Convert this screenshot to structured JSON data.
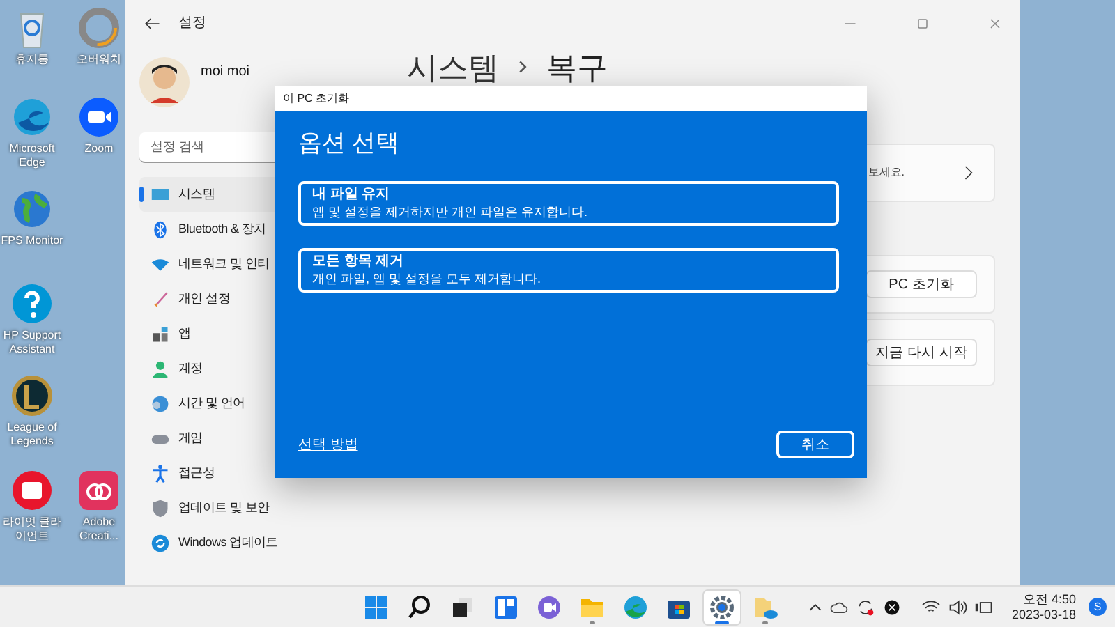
{
  "desktop_icons": [
    {
      "label": "휴지통",
      "kind": "recycle"
    },
    {
      "label": "오버워치",
      "kind": "ring"
    },
    {
      "label": "Microsoft Edge",
      "kind": "edge"
    },
    {
      "label": "Zoom",
      "kind": "zoom"
    },
    {
      "label": "FPS Monitor",
      "kind": "globe"
    },
    {
      "label": "HP Support Assistant",
      "kind": "help"
    },
    {
      "label": "League of Legends",
      "kind": "league"
    },
    {
      "label": "라이엇 클라이언트",
      "kind": "fist"
    },
    {
      "label": "Adobe Creati...",
      "kind": "adobe"
    }
  ],
  "settings": {
    "title": "설정",
    "user": {
      "name": "moi moi"
    },
    "search": {
      "placeholder": "설정 검색"
    },
    "sidebar": {
      "items": [
        {
          "label": "시스템",
          "kind": "system",
          "selected": true
        },
        {
          "label": "Bluetooth & 장치",
          "kind": "bluetooth",
          "selected": false
        },
        {
          "label": "네트워크 및 인터",
          "kind": "network",
          "selected": false
        },
        {
          "label": "개인 설정",
          "kind": "brush",
          "selected": false
        },
        {
          "label": "앱",
          "kind": "apps",
          "selected": false
        },
        {
          "label": "계정",
          "kind": "person",
          "selected": false
        },
        {
          "label": "시간 및 언어",
          "kind": "globe",
          "selected": false
        },
        {
          "label": "게임",
          "kind": "game",
          "selected": false
        },
        {
          "label": "접근성",
          "kind": "access",
          "selected": false
        },
        {
          "label": "업데이트 및 보안",
          "kind": "shield",
          "selected": false
        },
        {
          "label": "Windows 업데이트",
          "kind": "update",
          "selected": false
        }
      ]
    },
    "breadcrumb": [
      "시스템",
      "복구"
    ],
    "cards": [
      {
        "text": "보세요.",
        "kind": "link"
      },
      {
        "button": "PC 초기화",
        "kind": "button"
      },
      {
        "button": "지금 다시 시작",
        "kind": "button"
      }
    ]
  },
  "dialog": {
    "title": "이 PC 초기화",
    "heading": "옵션 선택",
    "options": [
      {
        "title": "내 파일 유지",
        "description": "앱 및 설정을 제거하지만 개인 파일은 유지합니다."
      },
      {
        "title": "모든 항목 제거",
        "description": "개인 파일, 앱 및 설정을 모두 제거합니다."
      }
    ],
    "link": "선택 방법",
    "cancel": "취소"
  },
  "taskbar": {
    "apps": [
      {
        "kind": "start",
        "running": false,
        "selected": false
      },
      {
        "kind": "search",
        "running": false,
        "selected": false
      },
      {
        "kind": "taskview",
        "running": false,
        "selected": false
      },
      {
        "kind": "widgets",
        "running": false,
        "selected": false
      },
      {
        "kind": "chat",
        "running": false,
        "selected": false
      },
      {
        "kind": "explorer",
        "running": true,
        "selected": false
      },
      {
        "kind": "edge",
        "running": false,
        "selected": false
      },
      {
        "kind": "store",
        "running": false,
        "selected": false
      },
      {
        "kind": "settings",
        "running": true,
        "selected": true
      },
      {
        "kind": "onedrive",
        "running": true,
        "selected": false
      }
    ],
    "time": "오전 4:50",
    "date": "2023-03-18",
    "badge": "S"
  }
}
